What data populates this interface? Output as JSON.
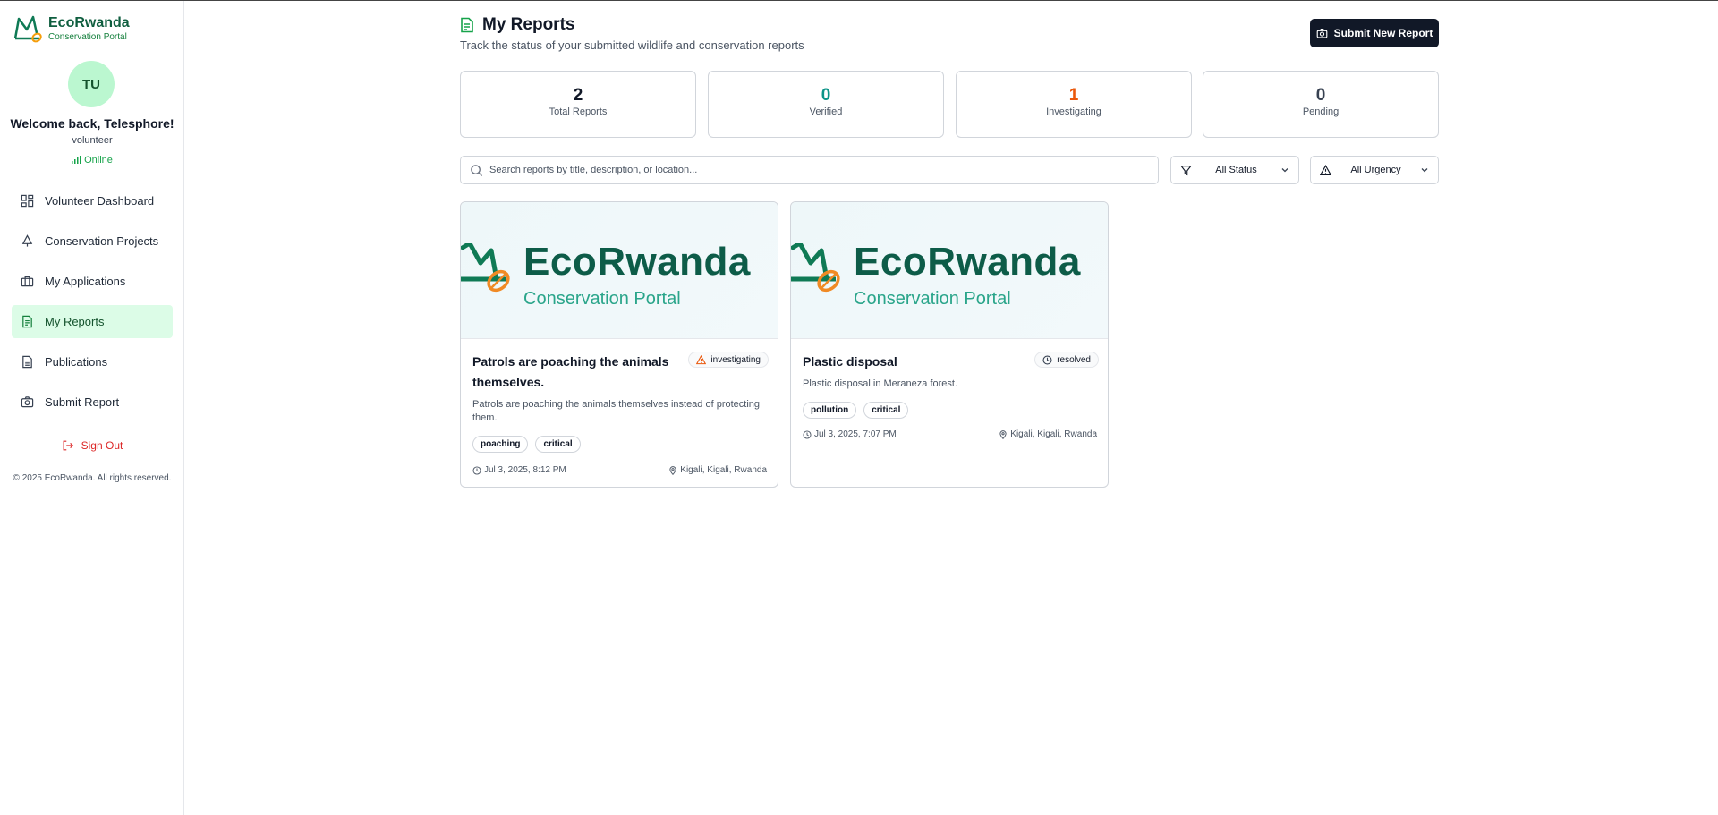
{
  "brand": {
    "name": "EcoRwanda",
    "subtitle": "Conservation Portal"
  },
  "user": {
    "initials": "TU",
    "welcome": "Welcome back, Telesphore!",
    "role": "volunteer",
    "status": "Online"
  },
  "nav": {
    "items": [
      {
        "label": "Volunteer Dashboard",
        "icon": "dashboard-icon"
      },
      {
        "label": "Conservation Projects",
        "icon": "tree-icon"
      },
      {
        "label": "My Applications",
        "icon": "briefcase-icon"
      },
      {
        "label": "My Reports",
        "icon": "document-icon",
        "active": true
      },
      {
        "label": "Publications",
        "icon": "file-icon"
      },
      {
        "label": "Submit Report",
        "icon": "camera-icon"
      }
    ],
    "sign_out": "Sign Out",
    "copyright": "© 2025 EcoRwanda. All rights reserved."
  },
  "header": {
    "title": "My Reports",
    "subtitle": "Track the status of your submitted wildlife and conservation reports",
    "submit_button": "Submit New Report"
  },
  "stats": [
    {
      "value": "2",
      "label": "Total Reports",
      "color": "#111827"
    },
    {
      "value": "0",
      "label": "Verified",
      "color": "#0d9488"
    },
    {
      "value": "1",
      "label": "Investigating",
      "color": "#ea580c"
    },
    {
      "value": "0",
      "label": "Pending",
      "color": "#374151"
    }
  ],
  "filters": {
    "search_placeholder": "Search reports by title, description, or location...",
    "status": "All Status",
    "urgency": "All Urgency"
  },
  "image_banner": {
    "title": "EcoRwanda",
    "subtitle": "Conservation Portal"
  },
  "reports": [
    {
      "title": "Patrols are poaching the animals themselves.",
      "status": "investigating",
      "description": "Patrols are poaching the animals themselves instead of protecting them.",
      "tags": [
        "poaching",
        "critical"
      ],
      "date": "Jul 3, 2025, 8:12 PM",
      "location": "Kigali, Kigali, Rwanda"
    },
    {
      "title": "Plastic disposal",
      "status": "resolved",
      "description": "Plastic disposal in Meraneza forest.",
      "tags": [
        "pollution",
        "critical"
      ],
      "date": "Jul 3, 2025, 7:07 PM",
      "location": "Kigali, Kigali, Rwanda"
    }
  ],
  "colors": {
    "brand": "#0f5e3f",
    "accent": "#16a34a",
    "active_bg": "#dcfce7",
    "danger": "#dc2626",
    "warning": "#ea580c"
  }
}
